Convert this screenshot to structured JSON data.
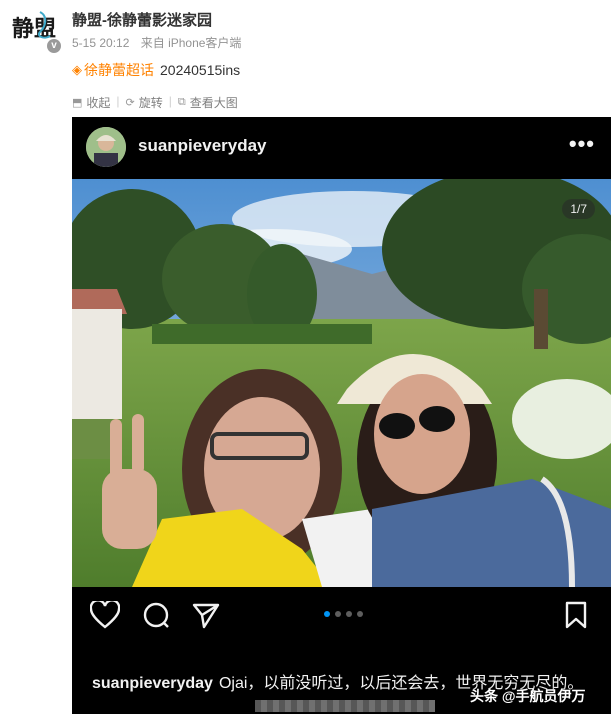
{
  "post": {
    "author": "静盟-徐静蕾影迷家园",
    "avatar_text": "静盟",
    "verified_mark": "v",
    "date": "5-15 20:12",
    "source": "来自 iPhone客户端",
    "tag_icon": "diamond-icon",
    "tag": "徐静蕾超话",
    "text": "20240515ins",
    "actions": [
      {
        "icon": "collect-icon",
        "label": "收起"
      },
      {
        "icon": "rotate-icon",
        "label": "旋转"
      },
      {
        "icon": "view-large-icon",
        "label": "查看大图"
      }
    ]
  },
  "instagram": {
    "username": "suanpieveryday",
    "more": "•••",
    "counter": "1/7",
    "carousel_dots": 4,
    "active_dot": 0,
    "caption_user": "suanpieveryday",
    "caption_text": "Ojai，以前没听过，以后还会去，世界无穷无尽的。"
  },
  "watermark": "头条 @手航员伊万",
  "colors": {
    "topic": "#ff8200",
    "ig_background": "#000000",
    "ig_active_dot": "#0095f6"
  }
}
